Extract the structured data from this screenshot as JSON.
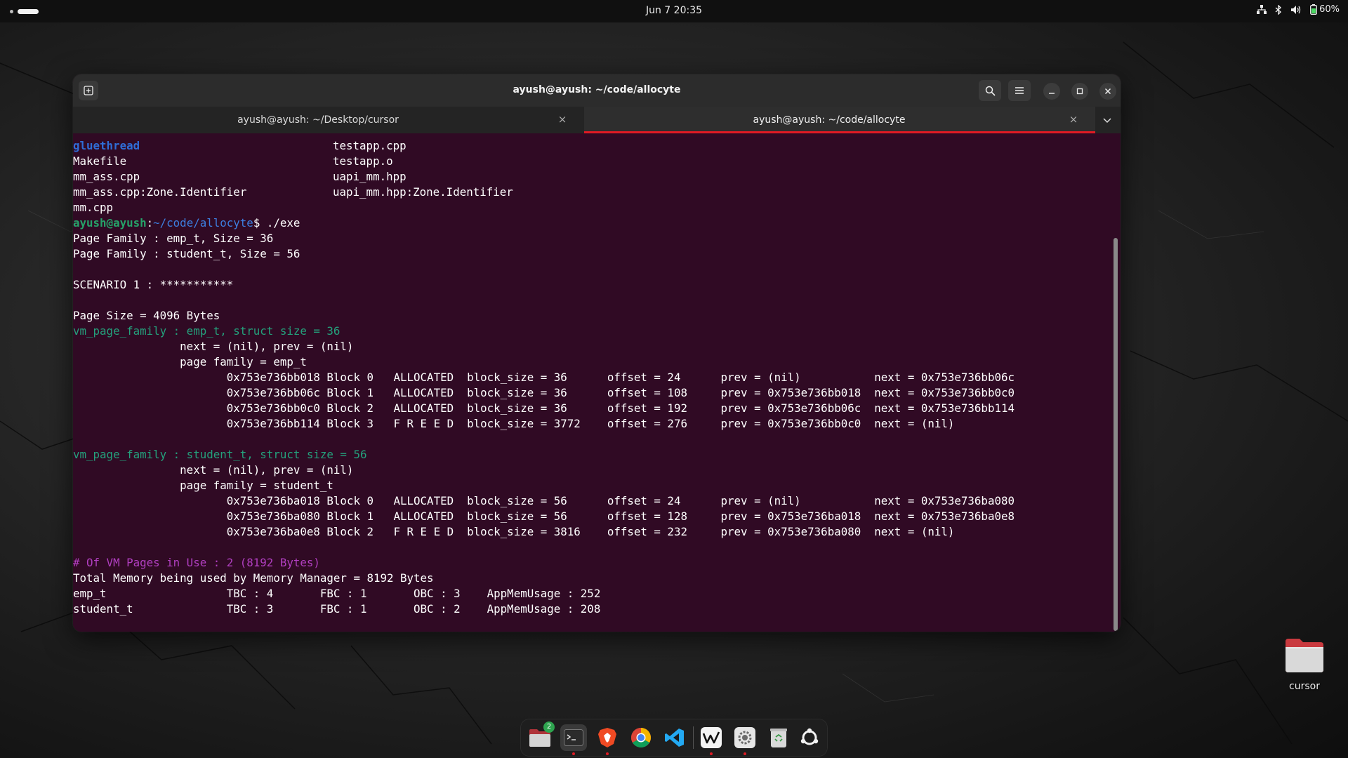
{
  "topbar": {
    "clock": "Jun 7  20:35",
    "battery": "60%"
  },
  "window": {
    "title": "ayush@ayush: ~/code/allocyte",
    "tabs": [
      {
        "label": "ayush@ayush: ~/Desktop/cursor",
        "active": false
      },
      {
        "label": "ayush@ayush: ~/code/allocyte",
        "active": true
      }
    ]
  },
  "terminal": {
    "colors": {
      "background": "#300a24",
      "prompt_user": "#26a269",
      "prompt_path": "#3d7fe0",
      "directory": "#2f6dd6",
      "family_header": "#24a17c",
      "summary_header": "#b13fc1"
    },
    "ls_rows": [
      {
        "left": "gluethread",
        "right": "testapp.cpp"
      },
      {
        "left": "Makefile",
        "right": "testapp.o"
      },
      {
        "left": "mm_ass.cpp",
        "right": "uapi_mm.hpp"
      },
      {
        "left": "mm_ass.cpp:Zone.Identifier",
        "right": "uapi_mm.hpp:Zone.Identifier"
      },
      {
        "left": "mm.cpp",
        "right": ""
      }
    ],
    "prompt": {
      "user": "ayush@ayush",
      "colon": ":",
      "path": "~/code/allocyte",
      "symbol": "$ ",
      "command": "./exe"
    },
    "page_families": [
      "Page Family : emp_t, Size = 36",
      "Page Family : student_t, Size = 56"
    ],
    "scenario": "SCENARIO 1 : ***********",
    "page_size": "Page Size = 4096 Bytes",
    "families": [
      {
        "header": "vm_page_family : emp_t, struct size = 36",
        "links": "                next = (nil), prev = (nil)",
        "name_line": "                page family = emp_t",
        "blocks": [
          "                       0x753e736bb018 Block 0   ALLOCATED  block_size = 36      offset = 24      prev = (nil)           next = 0x753e736bb06c",
          "                       0x753e736bb06c Block 1   ALLOCATED  block_size = 36      offset = 108     prev = 0x753e736bb018  next = 0x753e736bb0c0",
          "                       0x753e736bb0c0 Block 2   ALLOCATED  block_size = 36      offset = 192     prev = 0x753e736bb06c  next = 0x753e736bb114",
          "                       0x753e736bb114 Block 3   F R E E D  block_size = 3772    offset = 276     prev = 0x753e736bb0c0  next = (nil)"
        ]
      },
      {
        "header": "vm_page_family : student_t, struct size = 56",
        "links": "                next = (nil), prev = (nil)",
        "name_line": "                page family = student_t",
        "blocks": [
          "                       0x753e736ba018 Block 0   ALLOCATED  block_size = 56      offset = 24      prev = (nil)           next = 0x753e736ba080",
          "                       0x753e736ba080 Block 1   ALLOCATED  block_size = 56      offset = 128     prev = 0x753e736ba018  next = 0x753e736ba0e8",
          "                       0x753e736ba0e8 Block 2   F R E E D  block_size = 3816    offset = 232     prev = 0x753e736ba080  next = (nil)"
        ]
      }
    ],
    "vm_pages": "# Of VM Pages in Use : 2 (8192 Bytes)",
    "total_memory": "Total Memory being used by Memory Manager = 8192 Bytes",
    "usage_rows": [
      "emp_t                  TBC : 4       FBC : 1       OBC : 3    AppMemUsage : 252",
      "student_t              TBC : 3       FBC : 1       OBC : 2    AppMemUsage : 208"
    ]
  },
  "desktop": {
    "folder_label": "cursor"
  },
  "dock": {
    "items": [
      {
        "name": "files-icon",
        "badge": "2"
      },
      {
        "name": "terminal-icon"
      },
      {
        "name": "brave-browser-icon"
      },
      {
        "name": "chrome-icon"
      },
      {
        "name": "vscode-icon"
      },
      {
        "name": "windsurf-icon"
      },
      {
        "name": "settings-icon"
      },
      {
        "name": "trash-icon"
      },
      {
        "name": "show-apps-icon"
      }
    ]
  }
}
